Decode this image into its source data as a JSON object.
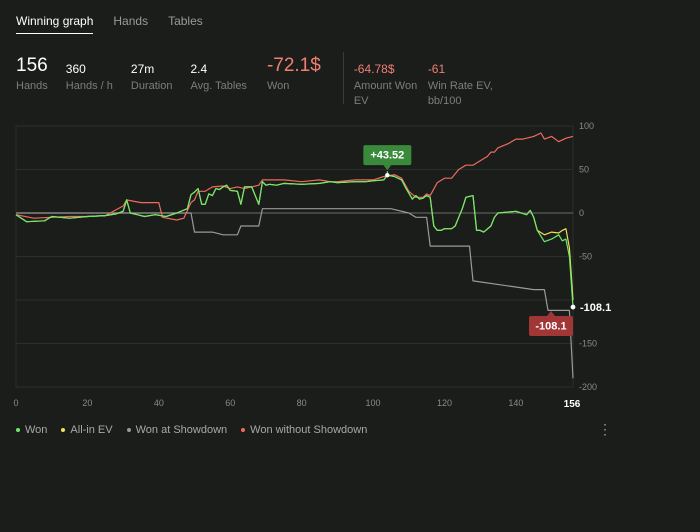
{
  "tabs": [
    {
      "label": "Winning graph",
      "active": true
    },
    {
      "label": "Hands",
      "active": false
    },
    {
      "label": "Tables",
      "active": false
    }
  ],
  "stats": {
    "hands": {
      "value": "156",
      "label": "Hands"
    },
    "hands_per_hour": {
      "value": "360",
      "label": "Hands / h"
    },
    "duration": {
      "value": "27m",
      "label": "Duration"
    },
    "avg_tables": {
      "value": "2.4",
      "label": "Avg. Tables"
    },
    "won": {
      "value": "-72.1$",
      "label": "Won"
    },
    "amount_won_ev": {
      "value": "-64.78$",
      "label": "Amount Won EV"
    },
    "win_rate_ev": {
      "value": "-61",
      "label": "Win Rate EV, bb/100"
    }
  },
  "colors": {
    "won": "#6ee86b",
    "allin_ev": "#f3de5a",
    "showdown": "#9a9a9a",
    "non_showdown": "#f06a60",
    "badge_green": "#3a8a3c",
    "badge_red": "#a13636"
  },
  "chart_data": {
    "type": "line",
    "xlim": [
      0,
      156
    ],
    "ylim": [
      -200,
      100
    ],
    "x_ticks": [
      0,
      20,
      40,
      60,
      80,
      100,
      120,
      140,
      156
    ],
    "y_ticks": [
      100,
      50,
      0,
      -50,
      -150,
      -200
    ],
    "grid": true,
    "legend_position": "bottom-left",
    "series": [
      {
        "name": "Won",
        "color_key": "won",
        "points": [
          [
            0,
            -2
          ],
          [
            3,
            -10
          ],
          [
            8,
            -9
          ],
          [
            10,
            -4
          ],
          [
            15,
            -6
          ],
          [
            20,
            -4
          ],
          [
            25,
            -3
          ],
          [
            28,
            -1
          ],
          [
            30,
            2
          ],
          [
            31,
            15
          ],
          [
            32,
            0
          ],
          [
            34,
            -2
          ],
          [
            36,
            -4
          ],
          [
            39,
            -2
          ],
          [
            42,
            -4
          ],
          [
            45,
            0
          ],
          [
            48,
            5
          ],
          [
            49,
            21
          ],
          [
            50,
            24
          ],
          [
            51,
            28
          ],
          [
            52,
            10
          ],
          [
            53,
            10
          ],
          [
            54,
            22
          ],
          [
            55,
            20
          ],
          [
            56,
            28
          ],
          [
            57,
            27
          ],
          [
            58,
            30
          ],
          [
            59,
            32
          ],
          [
            60,
            26
          ],
          [
            62,
            25
          ],
          [
            63,
            10
          ],
          [
            64,
            30
          ],
          [
            66,
            30
          ],
          [
            68,
            10
          ],
          [
            69,
            36
          ],
          [
            70,
            32
          ],
          [
            71,
            33
          ],
          [
            73,
            32
          ],
          [
            75,
            34
          ],
          [
            80,
            33
          ],
          [
            85,
            34
          ],
          [
            88,
            36
          ],
          [
            90,
            35
          ],
          [
            95,
            36
          ],
          [
            98,
            36
          ],
          [
            100,
            37
          ],
          [
            103,
            38
          ],
          [
            104,
            43.52
          ],
          [
            106,
            42
          ],
          [
            108,
            38
          ],
          [
            109,
            30
          ],
          [
            111,
            16
          ],
          [
            112,
            20
          ],
          [
            113,
            16
          ],
          [
            114,
            17
          ],
          [
            115,
            20
          ],
          [
            116,
            18
          ],
          [
            117,
            -15
          ],
          [
            118,
            -20
          ],
          [
            119,
            -20
          ],
          [
            120,
            -18
          ],
          [
            122,
            -18
          ],
          [
            123,
            -15
          ],
          [
            124,
            -5
          ],
          [
            125,
            5
          ],
          [
            126,
            18
          ],
          [
            128,
            20
          ],
          [
            129,
            -20
          ],
          [
            130,
            -20
          ],
          [
            131,
            -22
          ],
          [
            133,
            -15
          ],
          [
            134,
            -5
          ],
          [
            135,
            0
          ],
          [
            140,
            2
          ],
          [
            143,
            -2
          ],
          [
            144,
            3
          ],
          [
            145,
            -5
          ],
          [
            146,
            -20
          ],
          [
            148,
            -33
          ],
          [
            150,
            -30
          ],
          [
            152,
            -25
          ],
          [
            153,
            -32
          ],
          [
            154,
            -30
          ],
          [
            155,
            -50
          ],
          [
            156,
            -108.1
          ]
        ]
      },
      {
        "name": "All-in EV",
        "color_key": "allin_ev",
        "points": [
          [
            0,
            -2
          ],
          [
            3,
            -10
          ],
          [
            8,
            -9
          ],
          [
            10,
            -4
          ],
          [
            15,
            -6
          ],
          [
            20,
            -4
          ],
          [
            25,
            -3
          ],
          [
            28,
            -1
          ],
          [
            30,
            2
          ],
          [
            31,
            15
          ],
          [
            32,
            0
          ],
          [
            34,
            -2
          ],
          [
            36,
            -4
          ],
          [
            39,
            -2
          ],
          [
            42,
            -4
          ],
          [
            45,
            0
          ],
          [
            48,
            5
          ],
          [
            49,
            21
          ],
          [
            50,
            24
          ],
          [
            51,
            28
          ],
          [
            52,
            10
          ],
          [
            53,
            10
          ],
          [
            54,
            22
          ],
          [
            55,
            20
          ],
          [
            56,
            28
          ],
          [
            57,
            27
          ],
          [
            58,
            30
          ],
          [
            59,
            32
          ],
          [
            60,
            26
          ],
          [
            62,
            25
          ],
          [
            63,
            10
          ],
          [
            64,
            30
          ],
          [
            66,
            30
          ],
          [
            68,
            10
          ],
          [
            69,
            36
          ],
          [
            70,
            32
          ],
          [
            71,
            33
          ],
          [
            73,
            32
          ],
          [
            75,
            34
          ],
          [
            80,
            33
          ],
          [
            85,
            34
          ],
          [
            88,
            36
          ],
          [
            90,
            35
          ],
          [
            95,
            36
          ],
          [
            98,
            36
          ],
          [
            100,
            37
          ],
          [
            103,
            38
          ],
          [
            104,
            43.52
          ],
          [
            106,
            42
          ],
          [
            108,
            38
          ],
          [
            109,
            30
          ],
          [
            111,
            16
          ],
          [
            112,
            20
          ],
          [
            113,
            16
          ],
          [
            114,
            17
          ],
          [
            115,
            20
          ],
          [
            116,
            18
          ],
          [
            117,
            -15
          ],
          [
            118,
            -20
          ],
          [
            119,
            -20
          ],
          [
            120,
            -18
          ],
          [
            122,
            -18
          ],
          [
            123,
            -15
          ],
          [
            124,
            -5
          ],
          [
            125,
            5
          ],
          [
            126,
            18
          ],
          [
            128,
            20
          ],
          [
            129,
            -20
          ],
          [
            130,
            -20
          ],
          [
            131,
            -22
          ],
          [
            133,
            -15
          ],
          [
            134,
            -5
          ],
          [
            135,
            0
          ],
          [
            140,
            2
          ],
          [
            143,
            -2
          ],
          [
            144,
            3
          ],
          [
            145,
            -5
          ],
          [
            146,
            -20
          ],
          [
            148,
            -25
          ],
          [
            150,
            -22
          ],
          [
            152,
            -23
          ],
          [
            153,
            -20
          ],
          [
            154,
            -18
          ],
          [
            155,
            -40
          ],
          [
            156,
            -100
          ]
        ]
      },
      {
        "name": "Won at Showdown",
        "color_key": "showdown",
        "points": [
          [
            0,
            0
          ],
          [
            49,
            0
          ],
          [
            50,
            -22
          ],
          [
            55,
            -22
          ],
          [
            58,
            -25
          ],
          [
            62,
            -25
          ],
          [
            63,
            -15
          ],
          [
            68,
            -15
          ],
          [
            69,
            5
          ],
          [
            100,
            5
          ],
          [
            105,
            5
          ],
          [
            110,
            0
          ],
          [
            112,
            -5
          ],
          [
            115,
            -5
          ],
          [
            116,
            -38
          ],
          [
            125,
            -38
          ],
          [
            127,
            -38
          ],
          [
            128,
            -78
          ],
          [
            145,
            -88
          ],
          [
            148,
            -88
          ],
          [
            149,
            -112
          ],
          [
            155,
            -112
          ],
          [
            156,
            -190
          ]
        ]
      },
      {
        "name": "Won without Showdown",
        "color_key": "non_showdown",
        "points": [
          [
            0,
            -2
          ],
          [
            5,
            -6
          ],
          [
            10,
            -5
          ],
          [
            15,
            -4
          ],
          [
            20,
            -4
          ],
          [
            25,
            -3
          ],
          [
            30,
            8
          ],
          [
            31,
            15
          ],
          [
            35,
            12
          ],
          [
            40,
            12
          ],
          [
            41,
            -5
          ],
          [
            45,
            -8
          ],
          [
            47,
            -6
          ],
          [
            49,
            12
          ],
          [
            50,
            15
          ],
          [
            51,
            25
          ],
          [
            53,
            25
          ],
          [
            55,
            30
          ],
          [
            58,
            31
          ],
          [
            60,
            28
          ],
          [
            62,
            30
          ],
          [
            64,
            28
          ],
          [
            66,
            30
          ],
          [
            68,
            32
          ],
          [
            69,
            38
          ],
          [
            75,
            38
          ],
          [
            80,
            36
          ],
          [
            85,
            38
          ],
          [
            88,
            36
          ],
          [
            90,
            36
          ],
          [
            95,
            38
          ],
          [
            100,
            38
          ],
          [
            103,
            42
          ],
          [
            106,
            44
          ],
          [
            108,
            40
          ],
          [
            110,
            25
          ],
          [
            112,
            18
          ],
          [
            114,
            18
          ],
          [
            115,
            22
          ],
          [
            116,
            20
          ],
          [
            118,
            35
          ],
          [
            120,
            40
          ],
          [
            122,
            40
          ],
          [
            124,
            50
          ],
          [
            126,
            55
          ],
          [
            128,
            55
          ],
          [
            130,
            60
          ],
          [
            132,
            65
          ],
          [
            133,
            70
          ],
          [
            134,
            70
          ],
          [
            135,
            75
          ],
          [
            138,
            80
          ],
          [
            140,
            85
          ],
          [
            142,
            85
          ],
          [
            145,
            88
          ],
          [
            147,
            92
          ],
          [
            148,
            85
          ],
          [
            150,
            88
          ],
          [
            152,
            82
          ],
          [
            154,
            86
          ],
          [
            156,
            88
          ]
        ]
      }
    ],
    "annotations": [
      {
        "label": "+43.52",
        "x": 104,
        "y": 43.52,
        "style": "badge_green"
      },
      {
        "label": "-108.1",
        "x": 156,
        "y": -108.1,
        "style": "badge_red"
      }
    ],
    "end_label": "-108.1",
    "x_highlight_label": "156"
  },
  "legend": [
    {
      "label": "Won",
      "color_key": "won"
    },
    {
      "label": "All-in EV",
      "color_key": "allin_ev"
    },
    {
      "label": "Won at Showdown",
      "color_key": "showdown"
    },
    {
      "label": "Won without Showdown",
      "color_key": "non_showdown"
    }
  ],
  "menu": {
    "kebab_icon": "⋮"
  }
}
